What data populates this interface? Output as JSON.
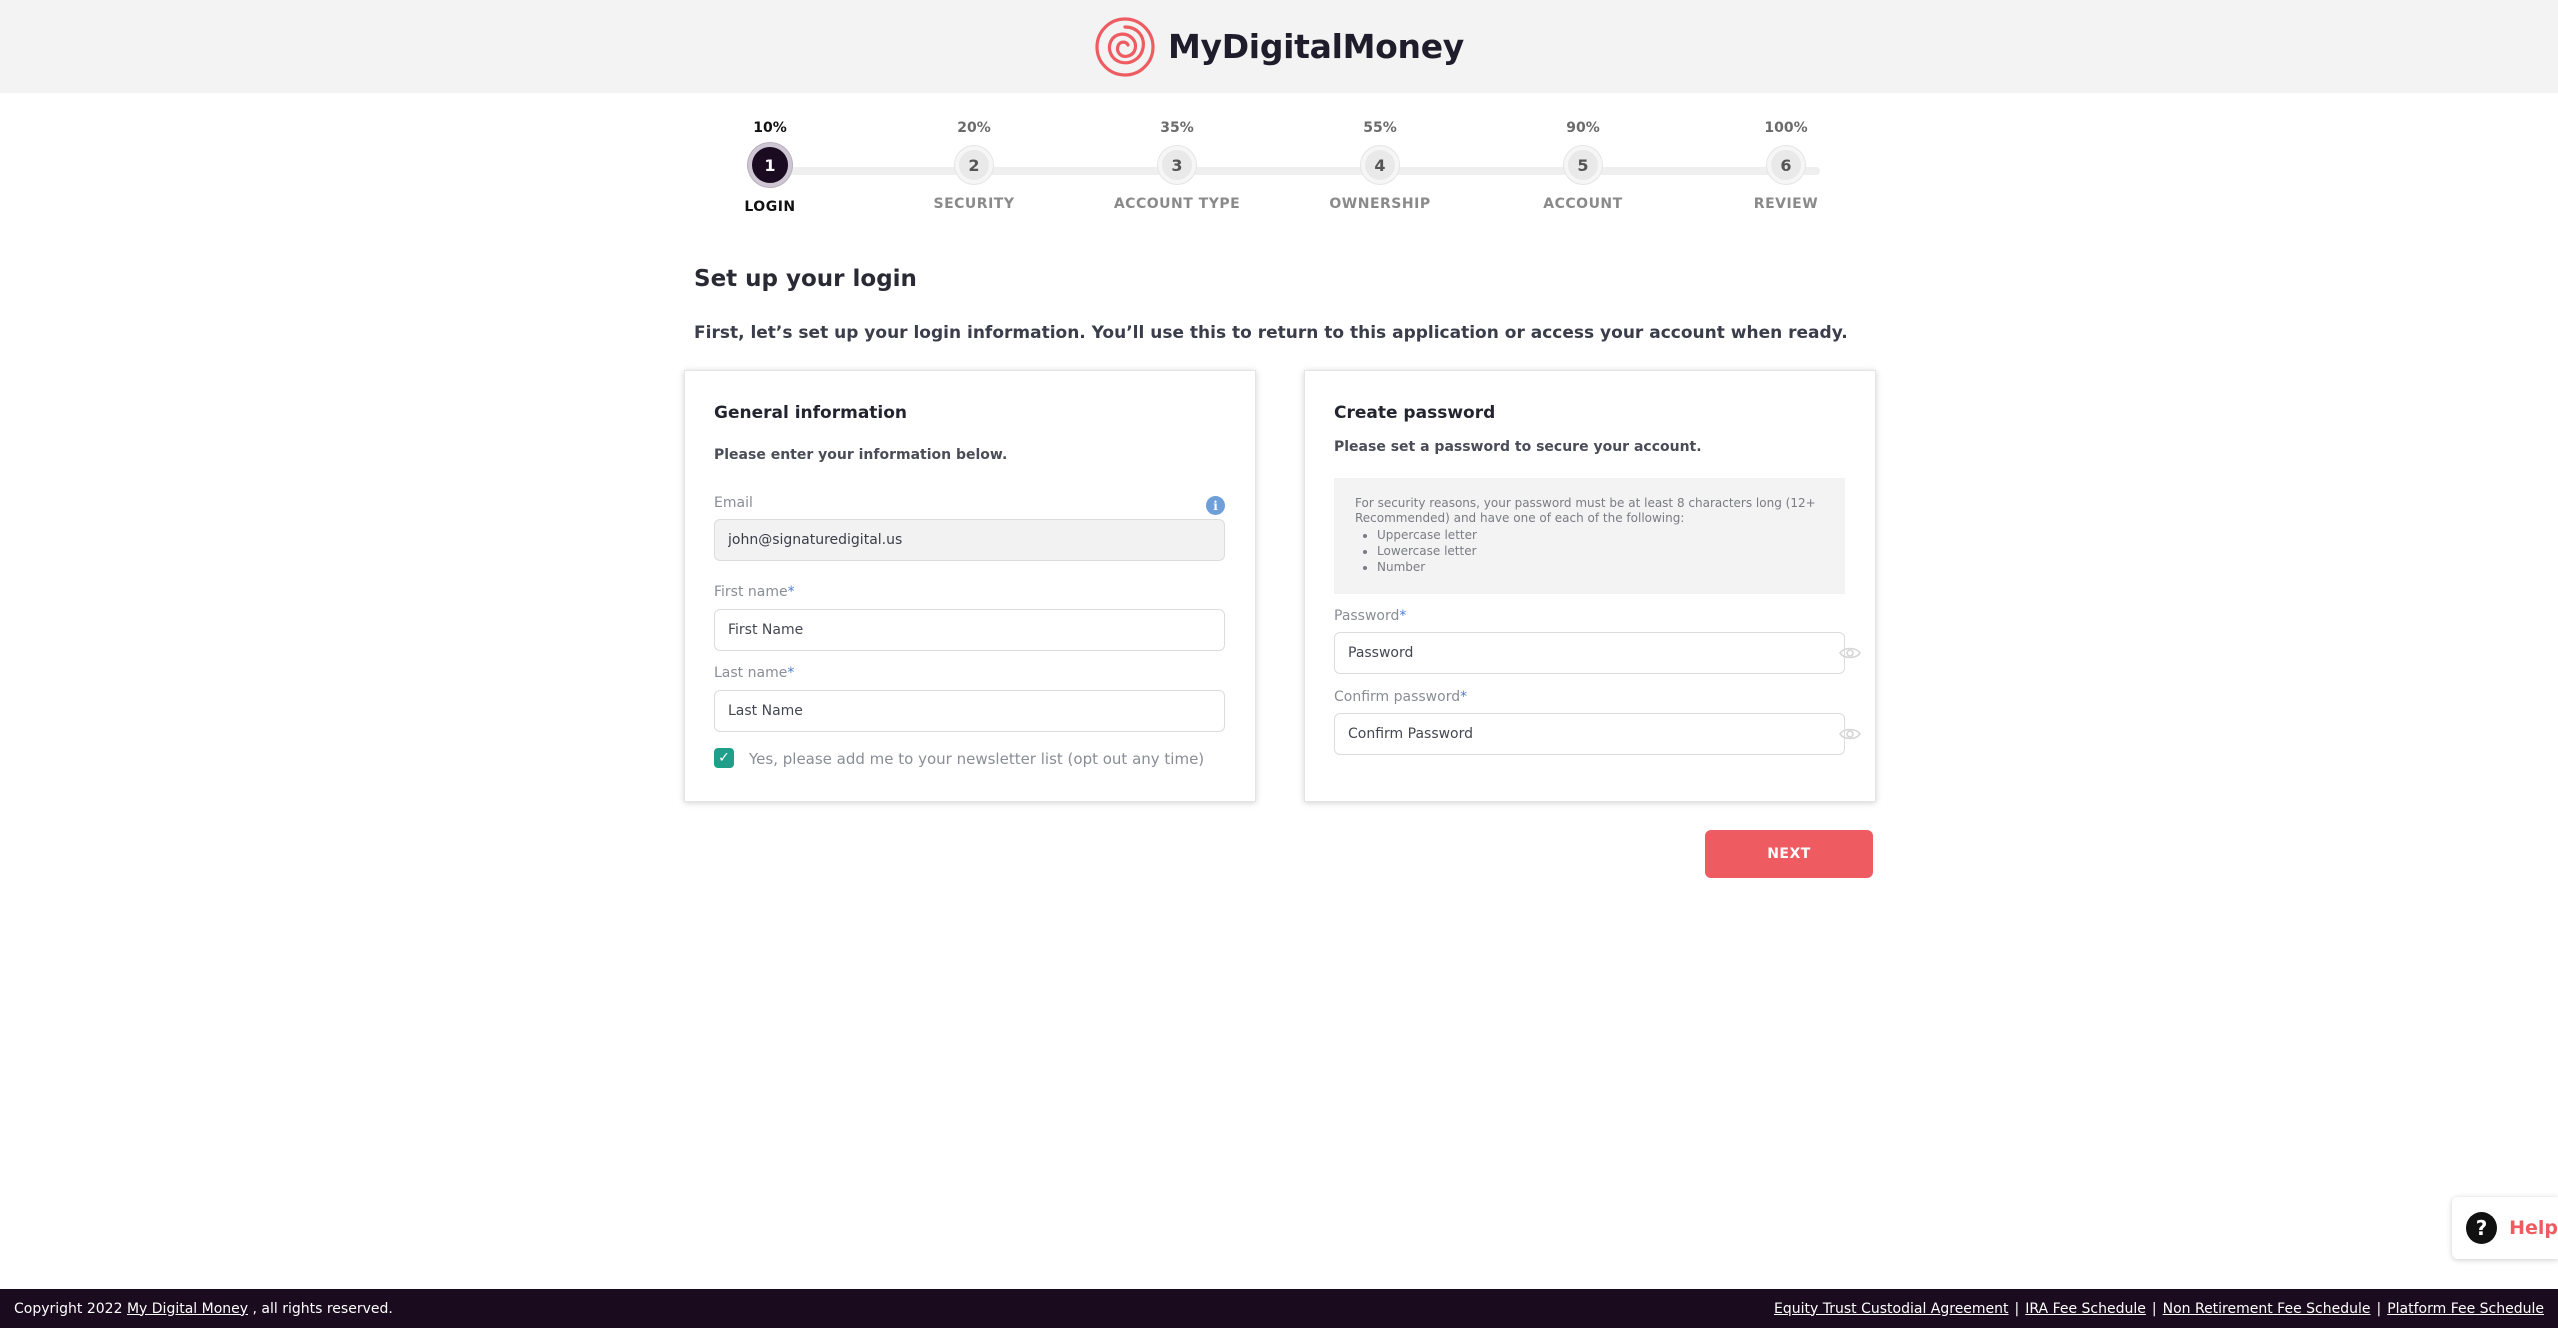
{
  "brand": {
    "name": "MyDigitalMoney",
    "accent": "#ee5b60",
    "dark": "#1a0b1e"
  },
  "stepper": {
    "steps": [
      {
        "number": "1",
        "percent": "10%",
        "label": "LOGIN",
        "active": true
      },
      {
        "number": "2",
        "percent": "20%",
        "label": "SECURITY",
        "active": false
      },
      {
        "number": "3",
        "percent": "35%",
        "label": "ACCOUNT TYPE",
        "active": false
      },
      {
        "number": "4",
        "percent": "55%",
        "label": "OWNERSHIP",
        "active": false
      },
      {
        "number": "5",
        "percent": "90%",
        "label": "ACCOUNT",
        "active": false
      },
      {
        "number": "6",
        "percent": "100%",
        "label": "REVIEW",
        "active": false
      }
    ]
  },
  "page": {
    "title": "Set up your login",
    "intro": "First, let’s set up your login information. You’ll use this to return to this application or access your account when ready."
  },
  "general": {
    "title": "General information",
    "subtitle": "Please enter your information below.",
    "email_label": "Email",
    "email_value": "john@signaturedigital.us",
    "first_name_label": "First name",
    "first_name_placeholder": "First Name",
    "last_name_label": "Last name",
    "last_name_placeholder": "Last Name",
    "required_mark": "*",
    "newsletter_label": "Yes, please add me to your newsletter list (opt out any time)",
    "newsletter_checked": true
  },
  "password": {
    "title": "Create password",
    "subtitle": "Please set a password to secure your account.",
    "note": "For security reasons, your password must be at least 8 characters long (12+ Recommended) and have one of each of the following:",
    "requirements": [
      "Uppercase letter",
      "Lowercase letter",
      "Number"
    ],
    "password_label": "Password",
    "password_placeholder": "Password",
    "confirm_label": "Confirm password",
    "confirm_placeholder": "Confirm Password",
    "required_mark": "*"
  },
  "actions": {
    "next_label": "NEXT"
  },
  "help": {
    "label": "Help"
  },
  "footer": {
    "copyright_prefix": "Copyright 2022",
    "company_link": "My Digital Money",
    "copyright_suffix": ", all rights reserved.",
    "links": [
      "Equity Trust Custodial Agreement",
      "IRA Fee Schedule",
      "Non Retirement Fee Schedule",
      "Platform Fee Schedule"
    ]
  }
}
